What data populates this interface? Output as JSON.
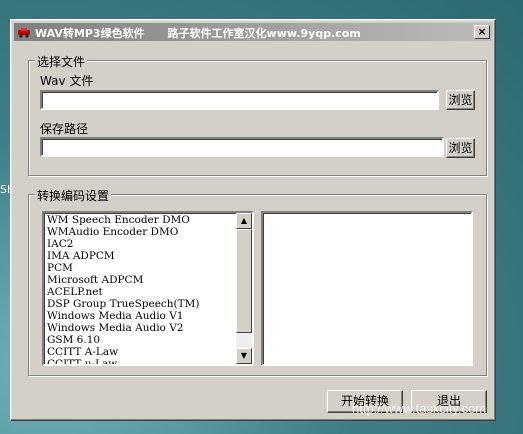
{
  "window": {
    "title": "WAV转MP3绿色软件      路子软件工作室汉化www.9yqp.com",
    "close_label": "×"
  },
  "select_file": {
    "legend": "选择文件",
    "wav_label": "Wav 文件",
    "wav_value": "",
    "browse1_label": "浏览",
    "save_label": "保存路径",
    "save_value": "",
    "browse2_label": "浏览"
  },
  "codec": {
    "legend": "转换编码设置",
    "items": [
      "WM Speech Encoder DMO",
      "WMAudio Encoder DMO",
      "IAC2",
      "IMA ADPCM",
      "PCM",
      "Microsoft ADPCM",
      "ACELP.net",
      "DSP Group TrueSpeech(TM)",
      "Windows Media Audio V1",
      "Windows Media Audio V2",
      "GSM 6.10",
      "CCITT A-Law",
      "CCITT u-Law"
    ],
    "format_items": []
  },
  "buttons": {
    "start_label": "开始转换",
    "exit_label": "退出"
  },
  "desktop": {
    "side_text": "Sh",
    "watermark": "http://www.taskcity.com"
  },
  "icons": {
    "app": "car-icon",
    "close": "close-icon",
    "scroll_up": "arrow-up-icon",
    "scroll_down": "arrow-down-icon"
  }
}
